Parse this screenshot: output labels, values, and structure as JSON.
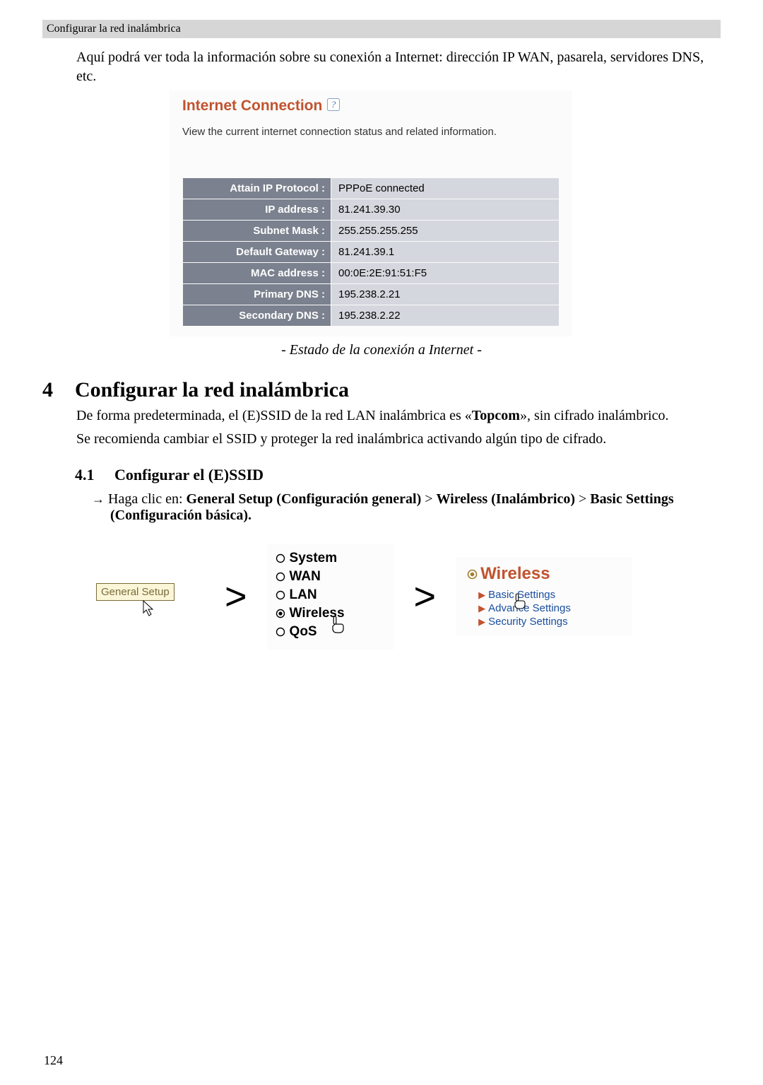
{
  "header": {
    "breadcrumb": "Configurar la red inalámbrica"
  },
  "intro": "Aquí podrá ver toda la información sobre su conexión a Internet: dirección IP WAN, pasarela, servidores DNS, etc.",
  "panel": {
    "title": "Internet Connection",
    "desc": "View the current internet connection status and related information.",
    "rows": [
      {
        "label": "Attain IP Protocol :",
        "value": "PPPoE connected"
      },
      {
        "label": "IP address :",
        "value": "81.241.39.30"
      },
      {
        "label": "Subnet Mask :",
        "value": "255.255.255.255"
      },
      {
        "label": "Default Gateway :",
        "value": "81.241.39.1"
      },
      {
        "label": "MAC address :",
        "value": "00:0E:2E:91:51:F5"
      },
      {
        "label": "Primary DNS :",
        "value": "195.238.2.21"
      },
      {
        "label": "Secondary DNS :",
        "value": "195.238.2.22"
      }
    ],
    "caption": "- Estado de la conexión a Internet -"
  },
  "section4": {
    "number": "4",
    "title": "Configurar la red inalámbrica",
    "p1a": "De forma predeterminada, el (E)SSID de la red LAN inalámbrica es «",
    "p1b": "Topcom",
    "p1c": "», sin cifrado inalámbrico.",
    "p2": "Se recomienda cambiar el SSID y proteger la red inalámbrica activando algún tipo de cifrado."
  },
  "sub41": {
    "number": "4.1",
    "title": "Configurar el (E)SSID",
    "bullet_pre": "Haga clic en: ",
    "b1": "General Setup (Configuración general)",
    "sep": " > ",
    "b2": "Wireless (Inalámbrico)",
    "b3": "Basic Settings (Configuración básica)."
  },
  "nav": {
    "general_setup": "General Setup",
    "menu": {
      "system": "System",
      "wan": "WAN",
      "lan": "LAN",
      "wireless": "Wireless",
      "qos": "QoS"
    },
    "right": {
      "title": "Wireless",
      "items": [
        "Basic Settings",
        "Advance Settings",
        "Security Settings"
      ]
    }
  },
  "page_number": "124"
}
